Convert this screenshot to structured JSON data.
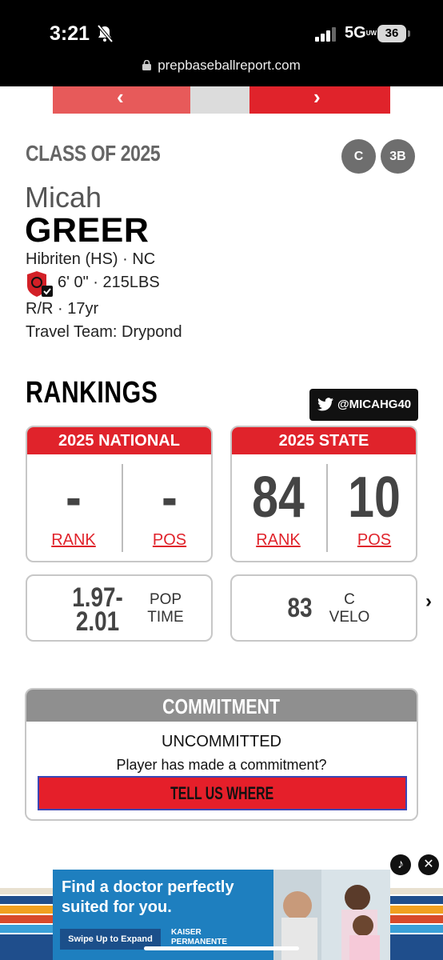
{
  "status_bar": {
    "time": "3:21",
    "network": "5G",
    "network_sub": "UW",
    "battery": "36"
  },
  "browser": {
    "url": "prepbaseballreport.com"
  },
  "carousel": {
    "prev_icon": "chevron-left-icon",
    "next_icon": "chevron-right-icon"
  },
  "player": {
    "class_label": "CLASS OF 2025",
    "positions": [
      "C",
      "3B"
    ],
    "first_name": "Micah",
    "last_name": "GREER",
    "school": "Hibriten (HS) · NC",
    "measurements": "6' 0\" · 215LBS",
    "bats_throws_age": "R/R · 17yr",
    "travel_team": "Travel Team: Drypond"
  },
  "rankings": {
    "title": "RANKINGS",
    "twitter_handle": "@MICAHG40",
    "national": {
      "header": "2025 NATIONAL",
      "rank_value": "-",
      "rank_label": "RANK",
      "pos_value": "-",
      "pos_label": "POS"
    },
    "state": {
      "header": "2025 STATE",
      "rank_value": "84",
      "rank_label": "RANK",
      "pos_value": "10",
      "pos_label": "POS"
    }
  },
  "stats": {
    "pop_time": {
      "value_line1": "1.97-",
      "value_line2": "2.01",
      "label_line1": "POP",
      "label_line2": "TIME"
    },
    "c_velo": {
      "value": "83",
      "label_line1": "C",
      "label_line2": "VELO"
    }
  },
  "commitment": {
    "header": "COMMITMENT",
    "status": "UNCOMMITTED",
    "question": "Player has made a commitment?",
    "button": "TELL US WHERE"
  },
  "ad": {
    "headline": "Find a doctor perfectly suited for you.",
    "swipe": "Swipe Up to Expand",
    "brand_line1": "KAISER",
    "brand_line2": "PERMANENTE"
  },
  "colors": {
    "brand_red": "#e0232b",
    "gray_header": "#8f8f8f",
    "ad_blue": "#1e7fbf"
  }
}
